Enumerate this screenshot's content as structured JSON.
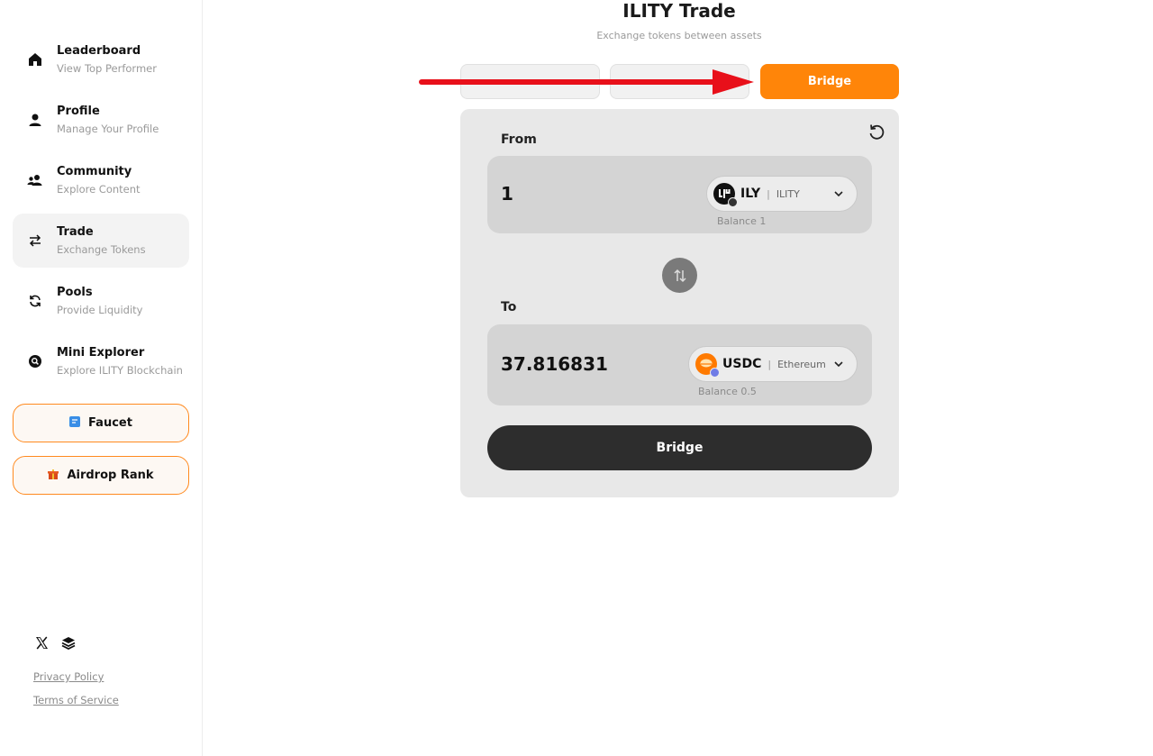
{
  "sidebar": {
    "items": [
      {
        "title": "Leaderboard",
        "subtitle": "View Top Performer",
        "icon": "home-icon"
      },
      {
        "title": "Profile",
        "subtitle": "Manage Your Profile",
        "icon": "user-icon"
      },
      {
        "title": "Community",
        "subtitle": "Explore Content",
        "icon": "users-icon"
      },
      {
        "title": "Trade",
        "subtitle": "Exchange Tokens",
        "icon": "swap-arrows-icon",
        "active": true
      },
      {
        "title": "Pools",
        "subtitle": "Provide Liquidity",
        "icon": "refresh-icon"
      },
      {
        "title": "Mini Explorer",
        "subtitle": "Explore ILITY Blockchain",
        "icon": "search-icon"
      }
    ],
    "faucet_label": "Faucet",
    "airdrop_label": "Airdrop Rank",
    "socials": [
      "x-icon",
      "layers-icon"
    ],
    "privacy_label": "Privacy Policy",
    "terms_label": "Terms of Service"
  },
  "header": {
    "title": "ILITY Trade",
    "subtitle": "Exchange tokens between assets"
  },
  "tabs": {
    "bridge": "Bridge",
    "active": "bridge"
  },
  "trade": {
    "from_label": "From",
    "to_label": "To",
    "from": {
      "amount": "1",
      "symbol": "ILY",
      "network": "ILITY",
      "balance": "Balance 1"
    },
    "to": {
      "amount": "37.816831",
      "symbol": "USDC",
      "network": "Ethereum",
      "balance": "Balance 0.5"
    },
    "submit_label": "Bridge"
  },
  "colors": {
    "accent": "#ff8509",
    "annotation_arrow": "#e8101a",
    "button_dark": "#2d2d2d"
  }
}
